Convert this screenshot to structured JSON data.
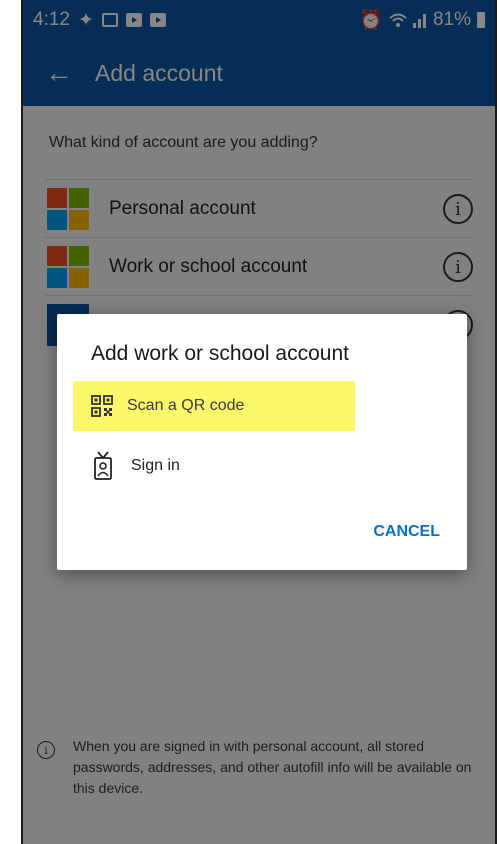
{
  "status_bar": {
    "time": "4:12",
    "battery_percent": "81%",
    "left_icons": [
      "sparkle-icon",
      "gallery-icon",
      "youtube-icon",
      "youtube-icon"
    ],
    "right_icons": [
      "alarm-icon",
      "wifi-icon",
      "signal-icon",
      "battery-icon"
    ]
  },
  "app_bar": {
    "back_icon": "back-arrow-icon",
    "title": "Add account"
  },
  "content": {
    "question": "What kind of account are you adding?",
    "accounts": [
      {
        "label": "Personal account",
        "icon": "microsoft-logo-icon",
        "info_icon": "info-icon"
      },
      {
        "label": "Work or school account",
        "icon": "microsoft-logo-icon",
        "info_icon": "info-icon"
      }
    ],
    "footer_note": "When you are signed in with personal account, all stored passwords, addresses, and other autofill info will be available on this device."
  },
  "dialog": {
    "title": "Add work or school account",
    "options": [
      {
        "label": "Scan a QR code",
        "icon": "qr-code-icon",
        "highlighted": true
      },
      {
        "label": "Sign in",
        "icon": "id-badge-icon",
        "highlighted": false
      }
    ],
    "cancel_label": "CANCEL"
  },
  "colors": {
    "app_bar": "#0b56a0",
    "accent": "#0b6fc6",
    "highlight": "#fbf86a"
  }
}
